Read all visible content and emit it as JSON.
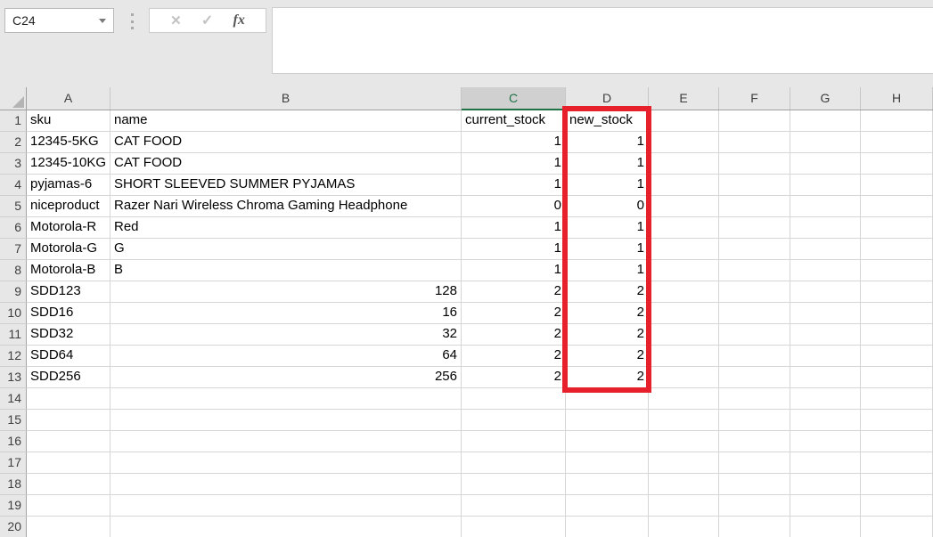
{
  "name_box": {
    "value": "C24"
  },
  "formula_bar": {
    "value": ""
  },
  "toolbar": {
    "cancel_icon": "✕",
    "enter_icon": "✓",
    "insert_function_icon": "fx"
  },
  "grid": {
    "column_headers": [
      "A",
      "B",
      "C",
      "D",
      "E",
      "F",
      "G",
      "H"
    ],
    "selected_column": "C",
    "total_rows": 20,
    "rows": [
      {
        "a": "sku",
        "b": "name",
        "c": "current_stock",
        "d": "new_stock"
      },
      {
        "a": "12345-5KG",
        "b": "CAT FOOD",
        "c": "1",
        "d": "1"
      },
      {
        "a": "12345-10KG",
        "b": "CAT FOOD",
        "c": "1",
        "d": "1"
      },
      {
        "a": "pyjamas-6",
        "b": "SHORT SLEEVED SUMMER PYJAMAS",
        "c": "1",
        "d": "1"
      },
      {
        "a": "niceproduct",
        "b": "Razer Nari Wireless Chroma Gaming Headphone",
        "c": "0",
        "d": "0"
      },
      {
        "a": "Motorola-R",
        "b": "Red",
        "c": "1",
        "d": "1"
      },
      {
        "a": "Motorola-G",
        "b": "G",
        "c": "1",
        "d": "1"
      },
      {
        "a": "Motorola-B",
        "b": "B",
        "c": "1",
        "d": "1"
      },
      {
        "a": "SDD123",
        "b": "128",
        "c": "2",
        "d": "2"
      },
      {
        "a": "SDD16",
        "b": "16",
        "c": "2",
        "d": "2"
      },
      {
        "a": "SDD32",
        "b": "32",
        "c": "2",
        "d": "2"
      },
      {
        "a": "SDD64",
        "b": "64",
        "c": "2",
        "d": "2"
      },
      {
        "a": "SDD256",
        "b": "256",
        "c": "2",
        "d": "2"
      }
    ]
  },
  "annotation": {
    "shape": "red-rectangle",
    "highlighted_column": "new_stock",
    "highlighted_rows": "1-13",
    "color": "#e8202c"
  },
  "colors": {
    "selection_green": "#217346",
    "highlight_red": "#e8202c",
    "chrome_background": "#e7e7e7"
  }
}
